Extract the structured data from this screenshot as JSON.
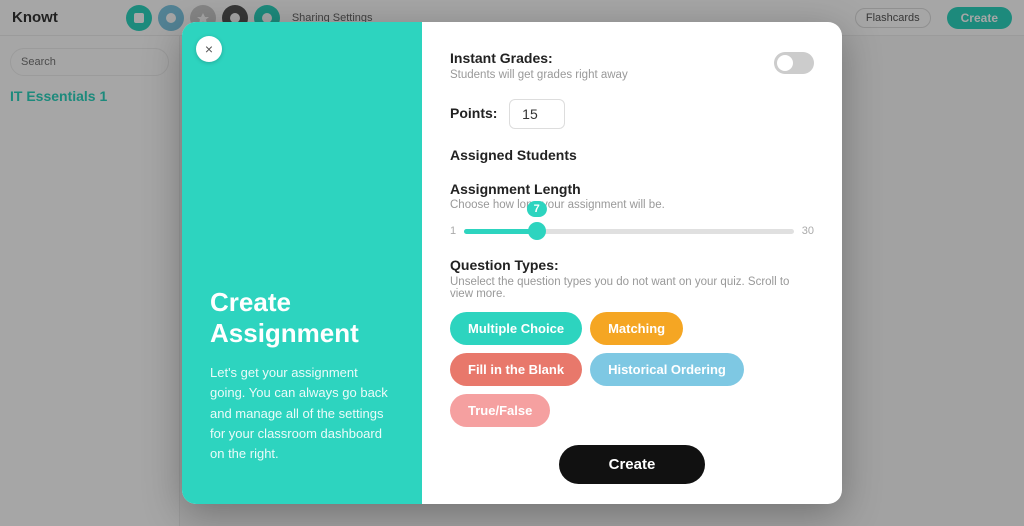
{
  "app": {
    "logo": "Knowt",
    "topbar": {
      "sharing_label": "Sharing Settings",
      "flashcards_label": "Flashcards",
      "create_label": "Create"
    }
  },
  "sidebar": {
    "search_placeholder": "Search",
    "title": "IT Essentials 1"
  },
  "modal": {
    "close_icon": "×",
    "left": {
      "title": "Create Assignment",
      "description": "Let's get your assignment going. You can always go back and manage all of the settings for your classroom dashboard on the right."
    },
    "instant_grades": {
      "label": "Instant Grades:",
      "sublabel": "Students will get grades right away",
      "enabled": false
    },
    "points": {
      "label": "Points:",
      "value": "15"
    },
    "assigned_students": {
      "label": "Assigned Students"
    },
    "assignment_length": {
      "label": "Assignment Length",
      "sublabel": "Choose how long your assignment will be.",
      "min": "1",
      "max": "30",
      "value": "7"
    },
    "question_types": {
      "label": "Question Types:",
      "sublabel": "Unselect the question types you do not want on your quiz. Scroll to view more.",
      "buttons": [
        {
          "id": "multiple-choice",
          "label": "Multiple Choice",
          "color": "#2DD4BF",
          "active": true
        },
        {
          "id": "matching",
          "label": "Matching",
          "color": "#F5A623",
          "active": true
        },
        {
          "id": "fill-in-blank",
          "label": "Fill in the Blank",
          "color": "#E8786B",
          "active": true
        },
        {
          "id": "historical-ordering",
          "label": "Historical Ordering",
          "color": "#7EC8E3",
          "active": true
        },
        {
          "id": "true-false",
          "label": "True/False",
          "color": "#F5A0A0",
          "active": true
        }
      ]
    },
    "create_button_label": "Create"
  }
}
